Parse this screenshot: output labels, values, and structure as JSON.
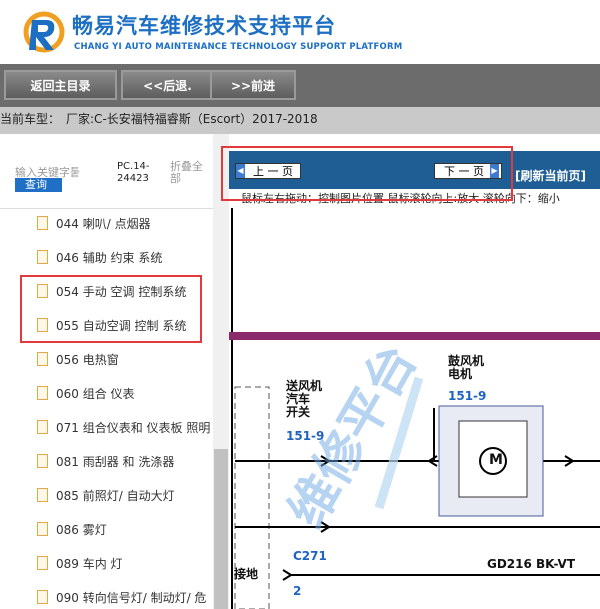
{
  "header": {
    "title": "畅易汽车维修技术支持平台",
    "subtitle": "CHANG YI AUTO MAINTENANCE TECHNOLOGY SUPPORT PLATFORM"
  },
  "nav": {
    "home": "返回主目录",
    "back": "<<后退.",
    "forward": ">>前进"
  },
  "vehicle": {
    "label": "当前车型：",
    "value": "厂家:C-长安福特福睿斯（Escort）2017-2018"
  },
  "sidebar": {
    "search_placeholder": "输入关键字퉅",
    "query": "查询",
    "pc_code": "PC.14-24423",
    "collapse": "折叠全部",
    "items": [
      {
        "label": "044 喇叭/ 点烟器"
      },
      {
        "label": "046 辅助 约束 系统"
      },
      {
        "label": "054 手动 空调 控制系统"
      },
      {
        "label": "055 自动空调 控制 系统"
      },
      {
        "label": "056 电热窗"
      },
      {
        "label": "060 组合 仪表"
      },
      {
        "label": "071 组合仪表和 仪表板 照明"
      },
      {
        "label": "081 雨刮器 和 洗涤器"
      },
      {
        "label": "085 前照灯/ 自动大灯"
      },
      {
        "label": "086 雾灯"
      },
      {
        "label": "089 车内 灯"
      },
      {
        "label": "090 转向信号灯/ 制动灯/ 危"
      }
    ]
  },
  "viewer": {
    "prev": "上 一 页",
    "next": "下 一 页",
    "refresh": "[刷新当前页]",
    "hint": "鼠标左右拖动：控制图片位置  鼠标滚轮向上:放大  滚轮向下：缩小",
    "diagram": {
      "blower_switch": "送风机\n汽车\n开关",
      "blower_switch_code": "151-9",
      "blower_motor": "鼓风机\n电机",
      "blower_motor_code": "151-9",
      "motor_symbol": "M",
      "connector": "C271",
      "connector_pin": "2",
      "wire": "GD216   BK-VT",
      "ground": "接地",
      "watermark": "维修平台"
    }
  },
  "colors": {
    "brand_blue": "#1d6fc4",
    "nav_gray": "#6c6c6c",
    "viewer_bar": "#1e5e95",
    "highlight_red": "#e23a3a"
  }
}
